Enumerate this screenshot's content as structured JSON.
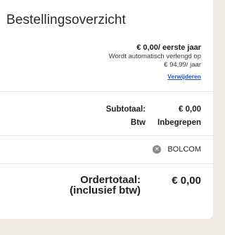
{
  "summary": {
    "title": "Bestellingsoverzicht",
    "item": {
      "price_line": "€ 0,00/ eerste jaar",
      "renew_text": "Wordt automatisch verlengd op",
      "renew_price": "€ 94,99/ jaar",
      "remove_label": "Verwijderen"
    },
    "subtotal": {
      "label": "Subtotaal:",
      "value": "€ 0,00"
    },
    "vat": {
      "label": "Btw",
      "value": "Inbegrepen"
    },
    "coupon": {
      "code": "BOLCOM",
      "remove_icon": "close-circle-icon"
    },
    "total": {
      "label_line1": "Ordertotaal:",
      "label_line2": "(inclusief btw)",
      "value": "€ 0,00"
    }
  }
}
